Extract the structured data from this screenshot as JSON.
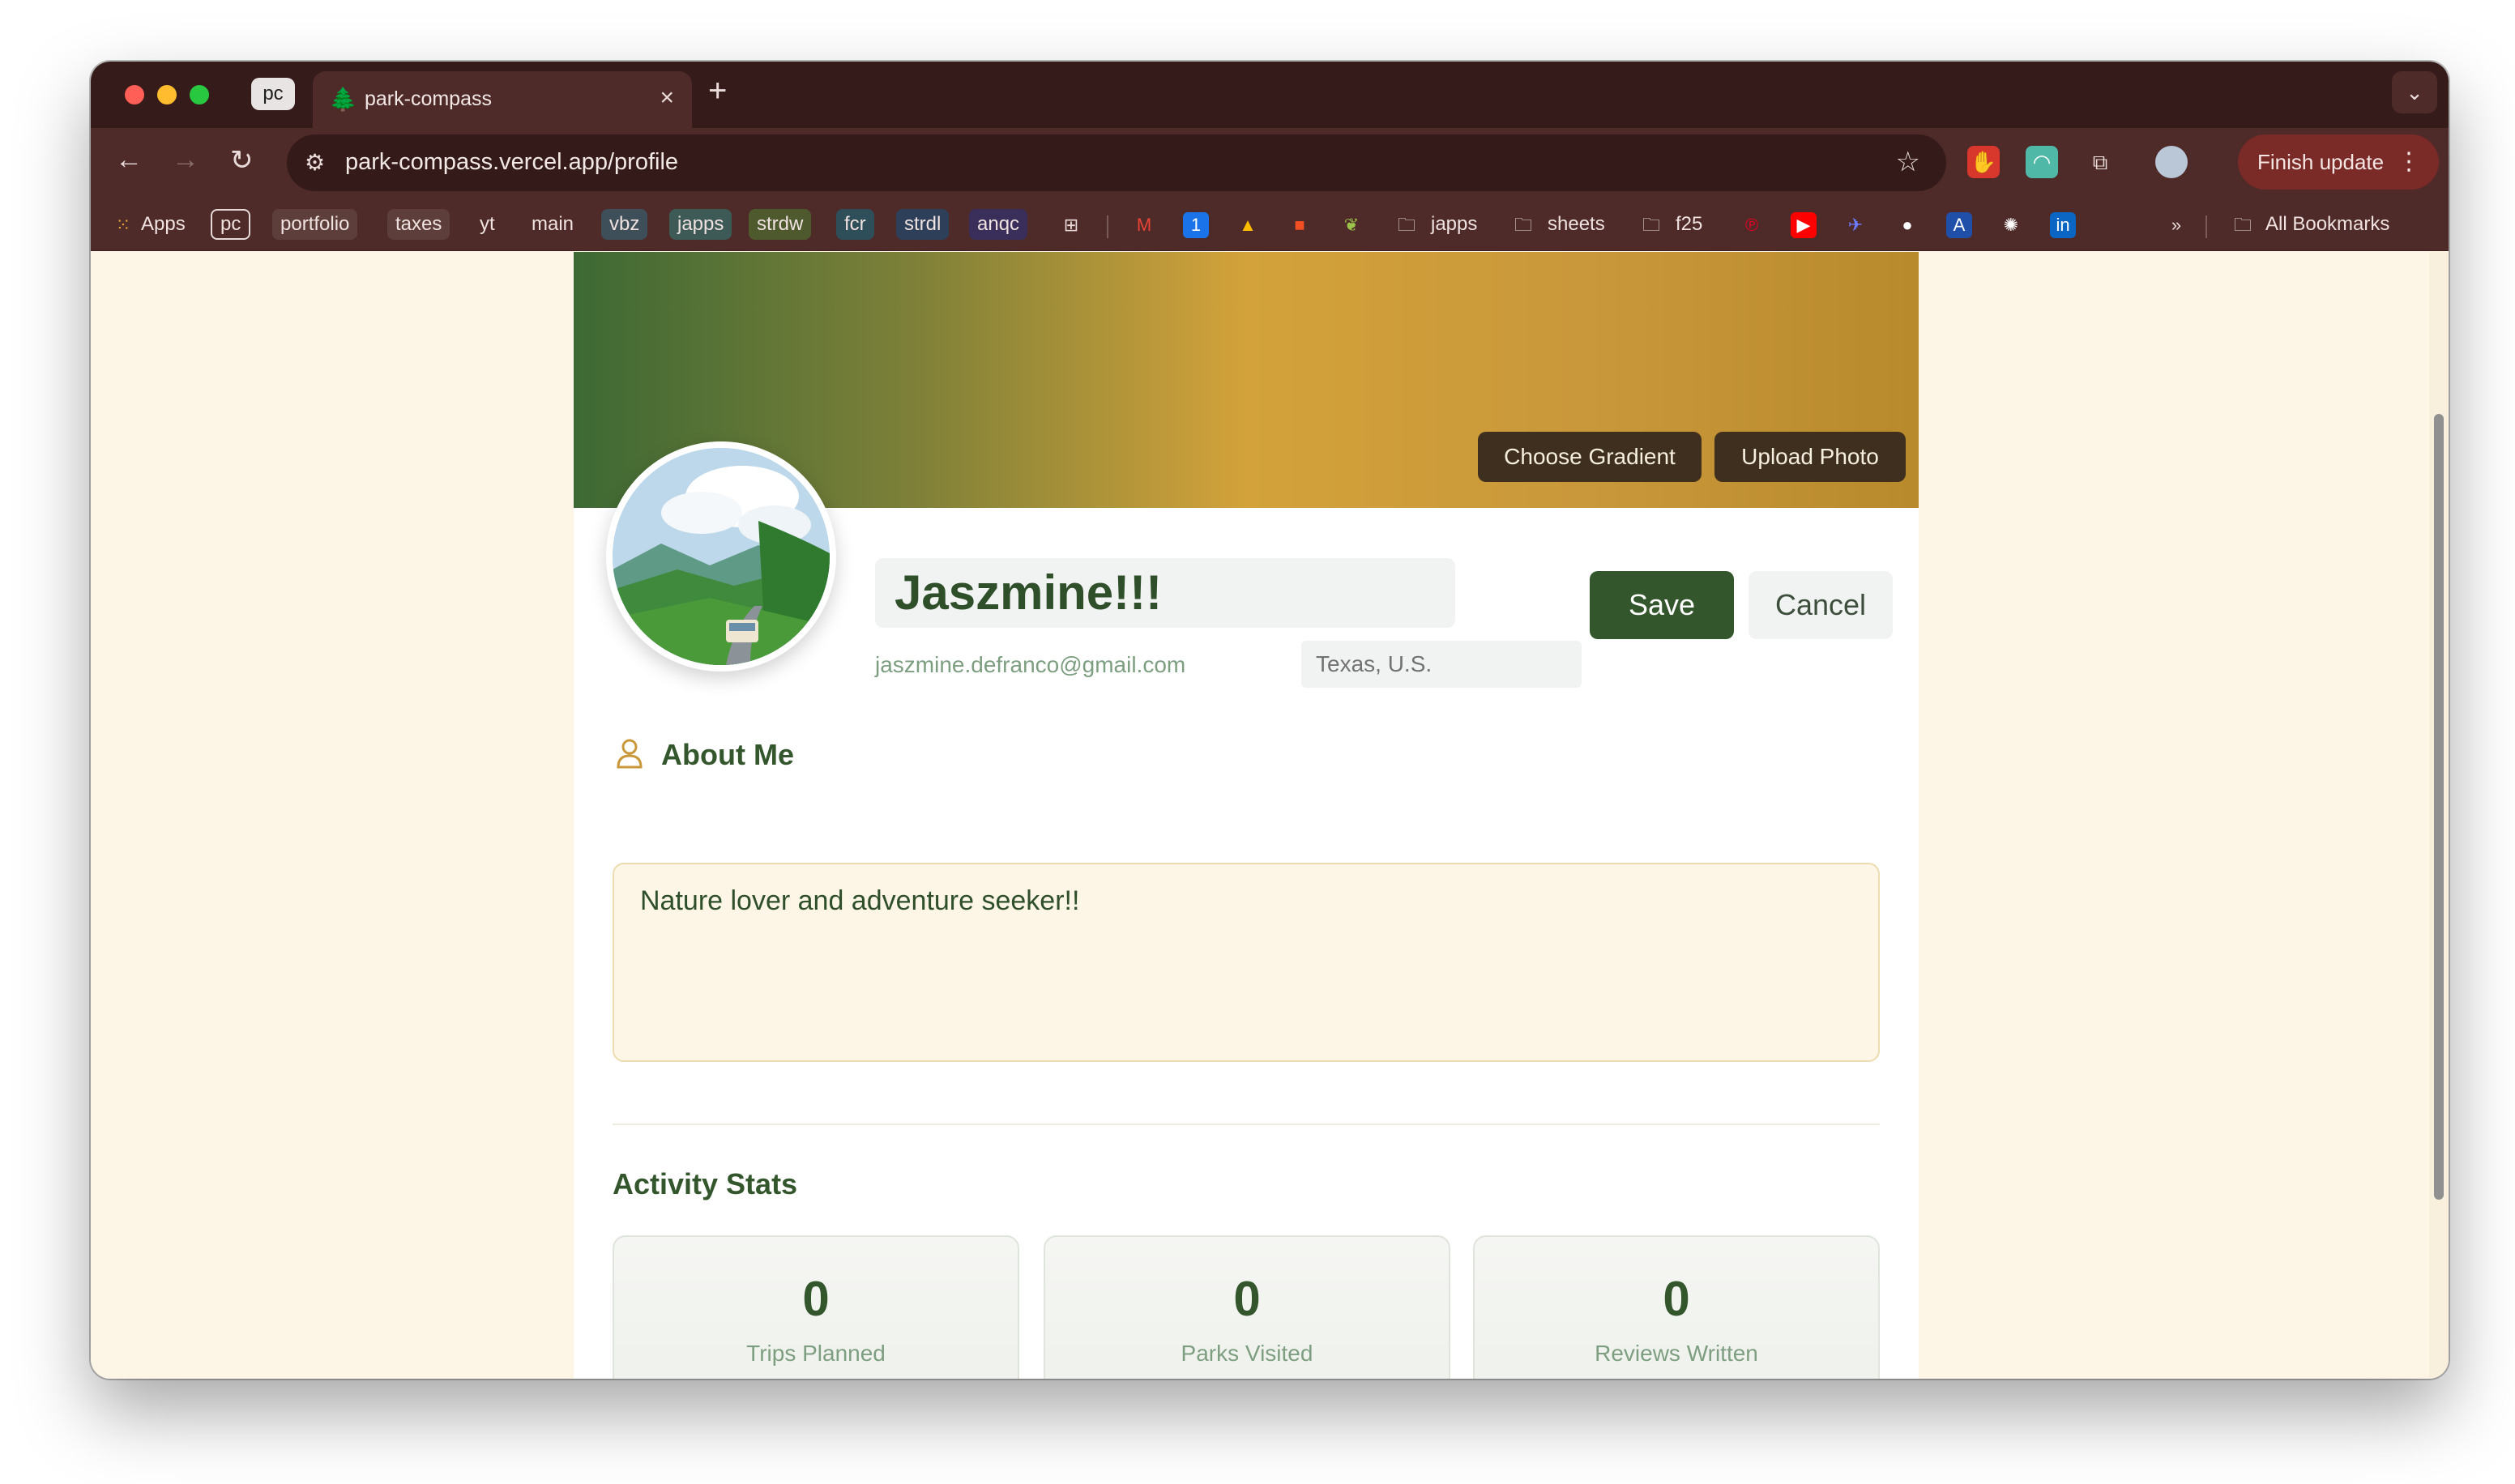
{
  "browser": {
    "profile_chip": "pc",
    "tab_title": "park-compass",
    "url": "park-compass.vercel.app/profile",
    "finish_update_label": "Finish update",
    "bookmarks_apps_label": "Apps",
    "bookmarks": [
      {
        "label": "pc"
      },
      {
        "label": "portfolio"
      },
      {
        "label": "taxes"
      },
      {
        "label": "yt"
      },
      {
        "label": "main"
      },
      {
        "label": "vbz"
      },
      {
        "label": "japps"
      },
      {
        "label": "strdw"
      },
      {
        "label": "fcr"
      },
      {
        "label": "strdl"
      },
      {
        "label": "anqc"
      }
    ],
    "bookmark_folders": [
      {
        "label": "japps"
      },
      {
        "label": "sheets"
      },
      {
        "label": "f25"
      }
    ],
    "all_bookmarks_label": "All Bookmarks"
  },
  "profile": {
    "choose_gradient_label": "Choose Gradient",
    "upload_photo_label": "Upload Photo",
    "name": "Jaszmine!!!",
    "email": "jaszmine.defranco@gmail.com",
    "location": "Texas, U.S.",
    "save_label": "Save",
    "cancel_label": "Cancel",
    "about_title": "About Me",
    "about_text": "Nature lover and adventure seeker!!",
    "stats_title": "Activity Stats",
    "stats": [
      {
        "value": "0",
        "label": "Trips Planned"
      },
      {
        "value": "0",
        "label": "Parks Visited"
      },
      {
        "value": "0",
        "label": "Reviews Written"
      }
    ]
  },
  "colors": {
    "brand_green": "#34562d",
    "cover_gradient_start": "#3d6934",
    "cover_gradient_mid": "#d3a23a",
    "page_background": "#fdf6e6"
  }
}
